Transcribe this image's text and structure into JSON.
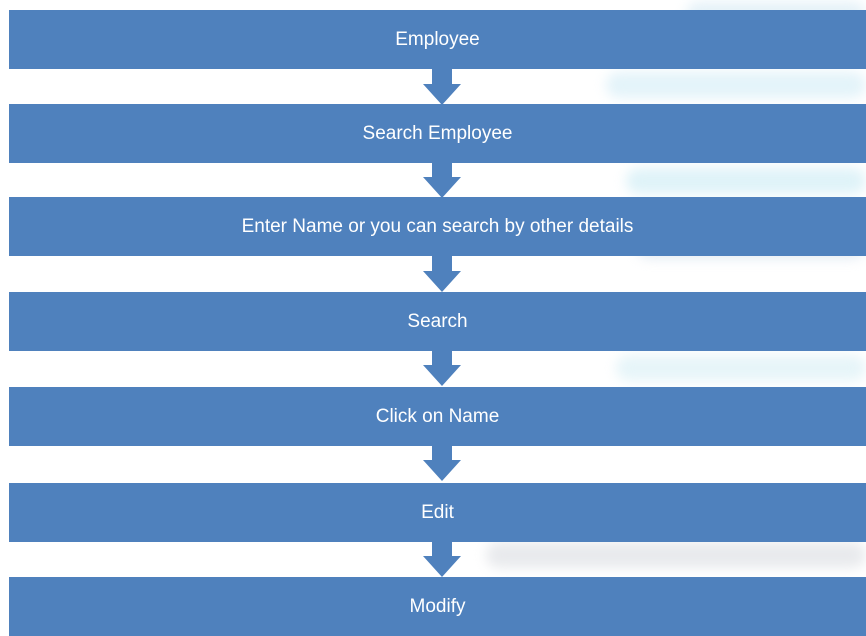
{
  "steps": [
    {
      "label": "Employee"
    },
    {
      "label": "Search Employee"
    },
    {
      "label": "Enter Name or you can search by other details"
    },
    {
      "label": "Search"
    },
    {
      "label": "Click on Name"
    },
    {
      "label": "Edit"
    },
    {
      "label": "Modify"
    }
  ],
  "colors": {
    "box": "#4f81bd",
    "arrow": "#4f81bd",
    "text": "#ffffff"
  }
}
